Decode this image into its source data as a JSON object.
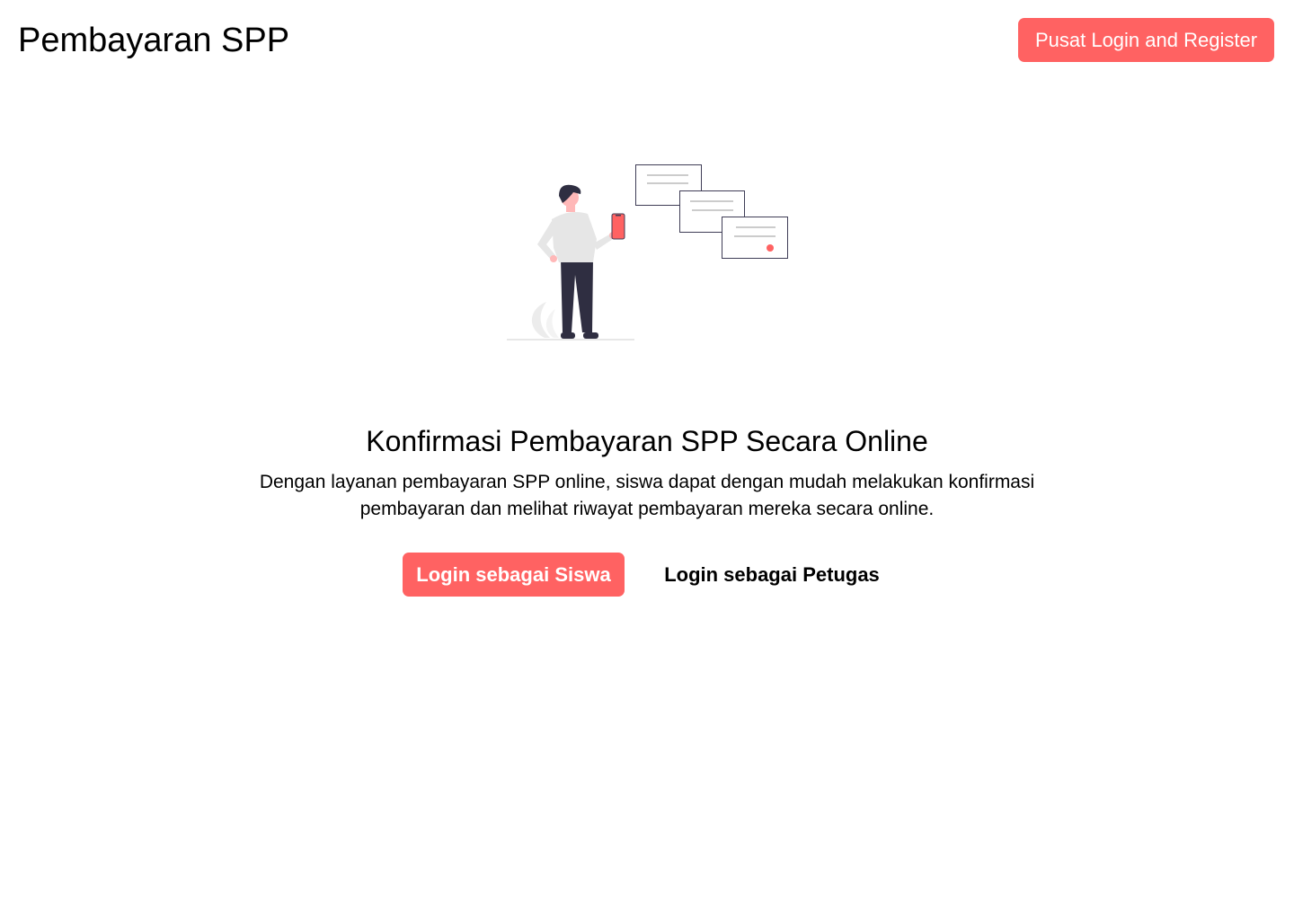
{
  "header": {
    "brand": "Pembayaran SPP",
    "login_register_label": "Pusat Login and Register"
  },
  "hero": {
    "illustration_icon": "person-holding-phone-with-payment-notifications-illustration",
    "title": "Konfirmasi Pembayaran SPP Secara Online",
    "description_line1": "Dengan layanan pembayaran SPP online, siswa dapat dengan mudah melakukan konfirmasi",
    "description_line2": "pembayaran dan melihat riwayat pembayaran mereka secara online."
  },
  "actions": {
    "student_login_label": "Login sebagai Siswa",
    "officer_login_label": "Login sebagai Petugas"
  },
  "colors": {
    "accent": "#ff6262",
    "text": "#000000",
    "background": "#ffffff"
  }
}
